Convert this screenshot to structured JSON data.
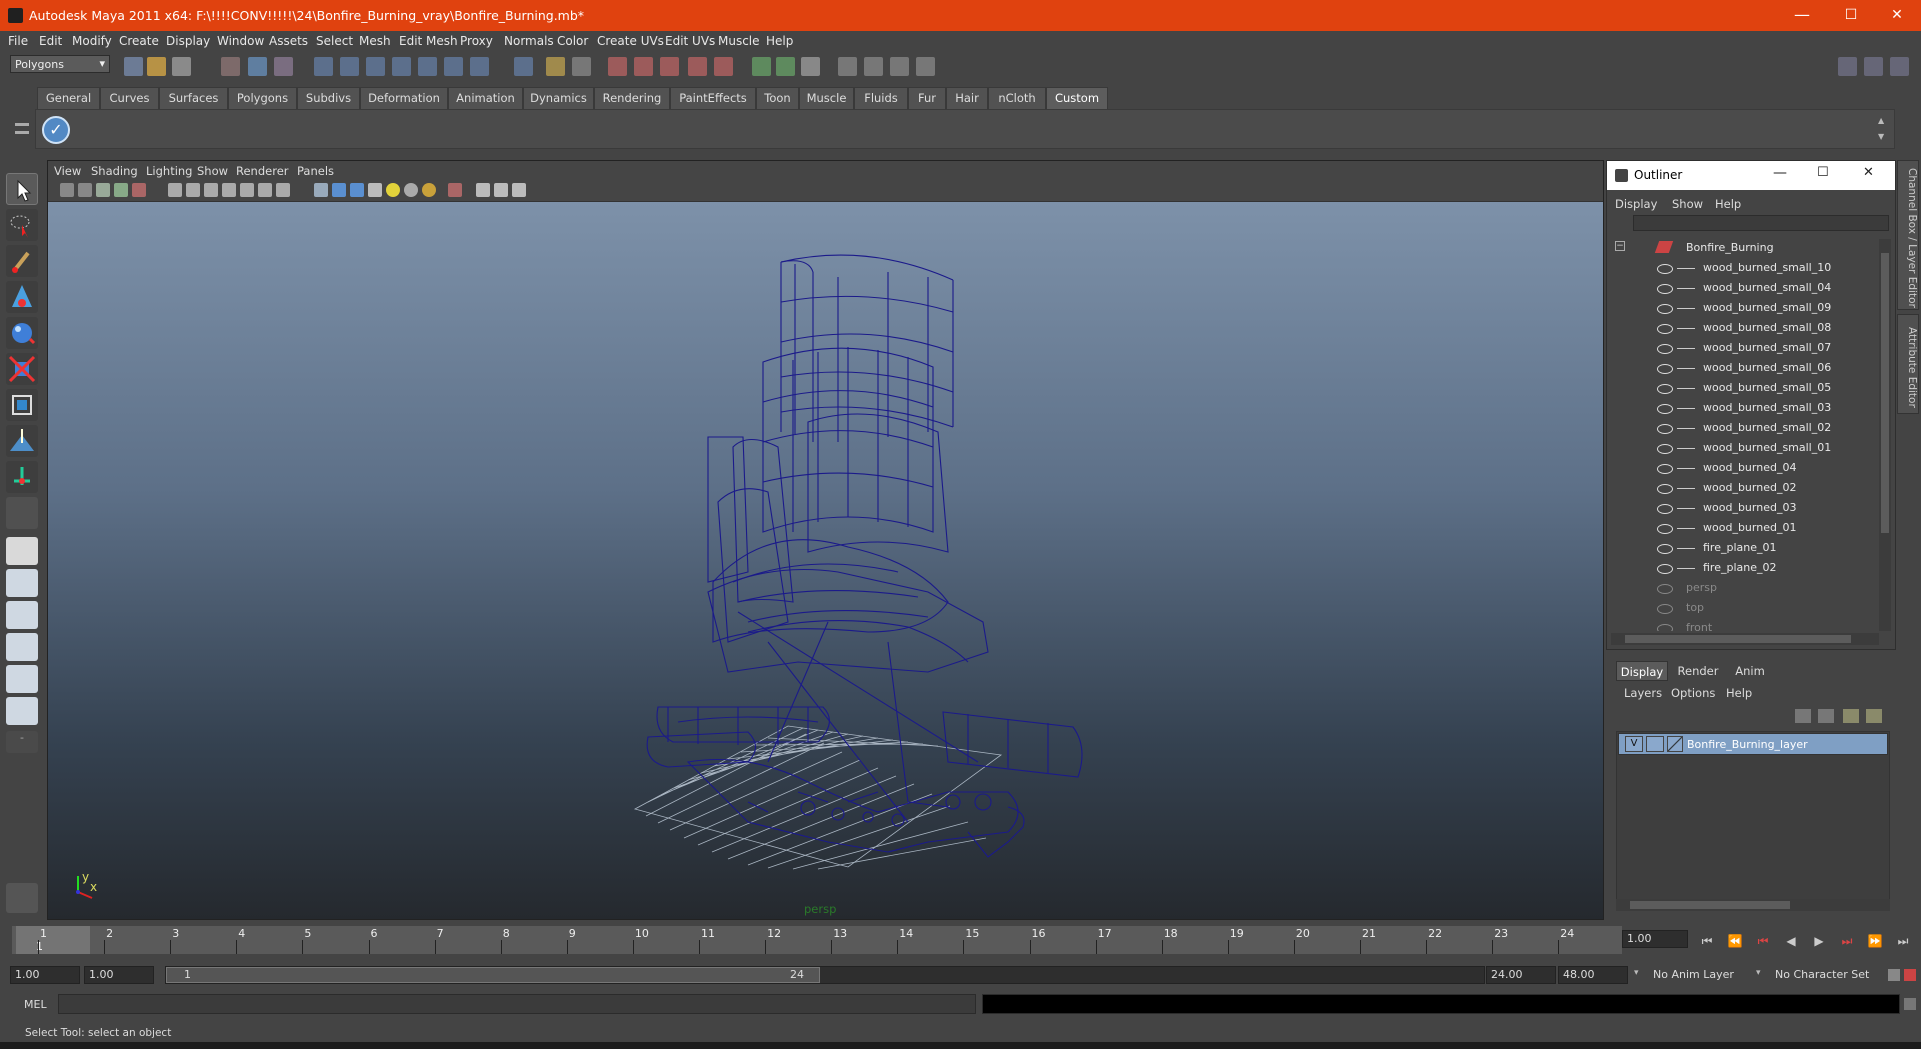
{
  "window": {
    "title": "Autodesk Maya 2011 x64: F:\\!!!!CONV!!!!!\\24\\Bonfire_Burning_vray\\Bonfire_Burning.mb*",
    "minimize": "—",
    "maximize": "☐",
    "close": "✕"
  },
  "menubar": [
    "File",
    "Edit",
    "Modify",
    "Create",
    "Display",
    "Window",
    "Assets",
    "Select",
    "Mesh",
    "Edit Mesh",
    "Proxy",
    "Normals",
    "Color",
    "Create UVs",
    "Edit UVs",
    "Muscle",
    "Help"
  ],
  "statusline": {
    "menu_set": "Polygons"
  },
  "shelf": {
    "tabs": [
      "General",
      "Curves",
      "Surfaces",
      "Polygons",
      "Subdivs",
      "Deformation",
      "Animation",
      "Dynamics",
      "Rendering",
      "PaintEffects",
      "Toon",
      "Muscle",
      "Fluids",
      "Fur",
      "Hair",
      "nCloth",
      "Custom"
    ],
    "active_tab": "Custom"
  },
  "viewport": {
    "menu": [
      "View",
      "Shading",
      "Lighting",
      "Show",
      "Renderer",
      "Panels"
    ],
    "camera_label": "persp",
    "axis_y": "y",
    "axis_x": "x"
  },
  "outliner": {
    "title": "Outliner",
    "menu": [
      "Display",
      "Show",
      "Help"
    ],
    "root": "Bonfire_Burning",
    "children": [
      "wood_burned_small_10",
      "wood_burned_small_04",
      "wood_burned_small_09",
      "wood_burned_small_08",
      "wood_burned_small_07",
      "wood_burned_small_06",
      "wood_burned_small_05",
      "wood_burned_small_03",
      "wood_burned_small_02",
      "wood_burned_small_01",
      "wood_burned_04",
      "wood_burned_02",
      "wood_burned_03",
      "wood_burned_01",
      "fire_plane_01",
      "fire_plane_02"
    ],
    "cameras": [
      "persp",
      "top",
      "front"
    ]
  },
  "side_tabs": {
    "channel_box": "Channel Box / Layer Editor",
    "attribute_editor": "Attribute Editor"
  },
  "layer_editor": {
    "tabs": [
      "Display",
      "Render",
      "Anim"
    ],
    "active_tab": "Display",
    "menu": [
      "Layers",
      "Options",
      "Help"
    ],
    "layer": {
      "visible": "V",
      "name": "Bonfire_Burning_layer"
    }
  },
  "timeline": {
    "ticks": [
      "1",
      "2",
      "3",
      "4",
      "5",
      "6",
      "7",
      "8",
      "9",
      "10",
      "11",
      "12",
      "13",
      "14",
      "15",
      "16",
      "17",
      "18",
      "19",
      "20",
      "21",
      "22",
      "23",
      "24"
    ],
    "current_frame_label": "1",
    "current_time": "1.00"
  },
  "range": {
    "start": "1.00",
    "playback_start": "1.00",
    "slider_start": "1",
    "slider_end": "24",
    "playback_end": "24.00",
    "end": "48.00",
    "anim_layer": "No Anim Layer",
    "character_set": "No Character Set"
  },
  "command": {
    "label": "MEL"
  },
  "helpline": "Select Tool: select an object",
  "colors": {
    "titlebar": "#e0420f",
    "wireframe": "#1b1a8a",
    "layer_selected": "#7f9fc4"
  }
}
